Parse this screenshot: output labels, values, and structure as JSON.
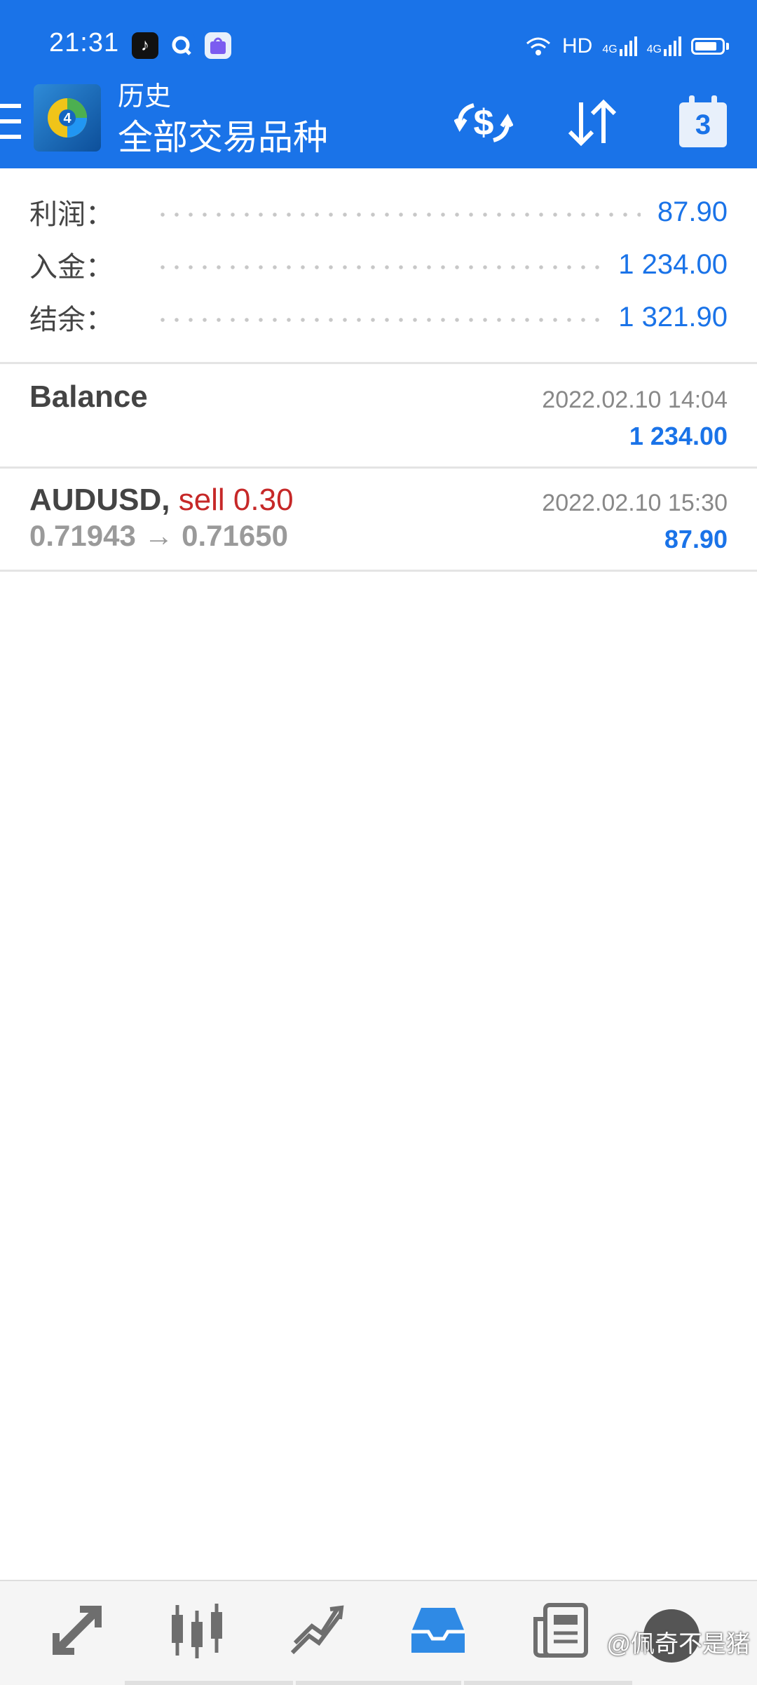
{
  "status_bar": {
    "time": "21:31",
    "network": "HD",
    "signal1": "4G",
    "signal2": "4G"
  },
  "toolbar": {
    "subtitle": "历史",
    "title": "全部交易品种"
  },
  "summary": {
    "profit": {
      "label": "利润：",
      "value": "87.90"
    },
    "deposit": {
      "label": "入金：",
      "value": "1 234.00"
    },
    "balance": {
      "label": "结余：",
      "value": "1 321.90"
    }
  },
  "deals": [
    {
      "title": "Balance",
      "time": "2022.02.10 14:04",
      "amount": "1 234.00"
    },
    {
      "symbol": "AUDUSD,",
      "action": "sell 0.30",
      "prices": "0.71943 → 0.71650",
      "time": "2022.02.10 15:30",
      "amount": "87.90"
    }
  ],
  "watermark": "@佩奇不是猪",
  "colors": {
    "accent": "#1a73e8",
    "sell": "#c62828",
    "muted": "#9a9a9a"
  }
}
